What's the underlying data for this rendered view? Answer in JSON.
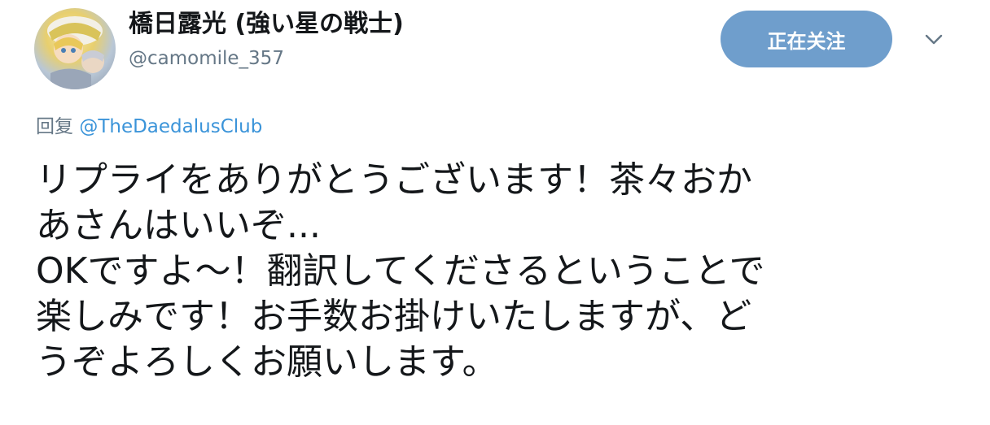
{
  "author": {
    "display_name": "橋日露光 (強い星の戦士)",
    "handle": "@camomile_357"
  },
  "follow_button": {
    "label": "正在关注",
    "color": "#6f9ecc"
  },
  "menu": {
    "icon": "chevron-down-icon"
  },
  "reply": {
    "prefix": "回复",
    "target": "@TheDaedalusClub"
  },
  "tweet": {
    "lines": [
      "リプライをありがとうございます！茶々おか",
      "あさんはいいぞ...",
      "OKですよ～！翻訳してくださるということで",
      "楽しみです！お手数お掛けいたしますが、ど",
      "うぞよろしくお願いします。"
    ]
  }
}
